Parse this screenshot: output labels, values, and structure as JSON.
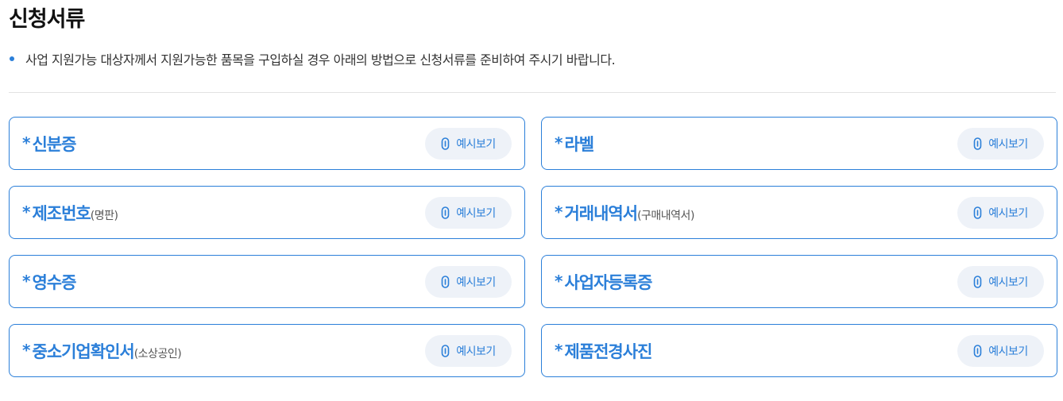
{
  "header": {
    "title": "신청서류",
    "notice": "사업 지원가능 대상자께서 지원가능한 품목을 구입하실 경우 아래의 방법으로 신청서류를 준비하여 주시기 바랍니다."
  },
  "documents": [
    {
      "star": "*",
      "label": "신분증",
      "sub": "",
      "button": "예시보기"
    },
    {
      "star": "*",
      "label": "라벨",
      "sub": "",
      "button": "예시보기"
    },
    {
      "star": "*",
      "label": "제조번호",
      "sub": "(명판)",
      "button": "예시보기"
    },
    {
      "star": "*",
      "label": "거래내역서",
      "sub": "(구매내역서)",
      "button": "예시보기"
    },
    {
      "star": "*",
      "label": "영수증",
      "sub": "",
      "button": "예시보기"
    },
    {
      "star": "*",
      "label": "사업자등록증",
      "sub": "",
      "button": "예시보기"
    },
    {
      "star": "*",
      "label": "중소기업확인서",
      "sub": "(소상공인)",
      "button": "예시보기"
    },
    {
      "star": "*",
      "label": "제품전경사진",
      "sub": "",
      "button": "예시보기"
    }
  ],
  "icons": {
    "preview": "paperclip-icon"
  },
  "colors": {
    "accent": "#2b7fd9",
    "button_bg": "#eef2f8",
    "divider": "#e2e2e2"
  }
}
